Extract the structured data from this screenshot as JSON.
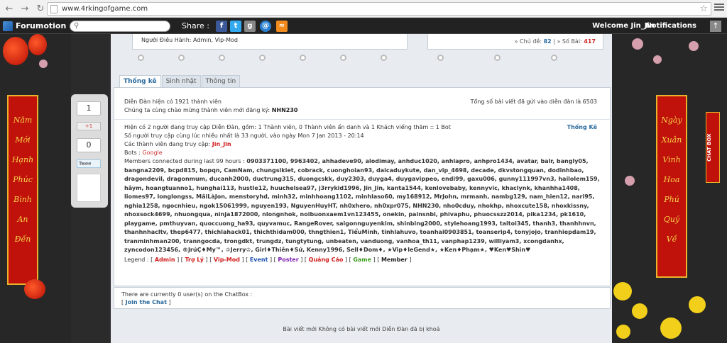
{
  "browser": {
    "url": "www.4rkingofgame.com"
  },
  "forumotion_bar": {
    "logo": "Forumotion",
    "share_label": "Share :",
    "welcome": "Welcome Jin_Jin",
    "notifications": "Notifications"
  },
  "banners": {
    "left": [
      "Năm",
      "Mới",
      "Hạnh",
      "Phúc",
      "Bình",
      "An",
      "Đến"
    ],
    "right": [
      "Ngày",
      "Xuân",
      "Vinh",
      "Hoa",
      "Phú",
      "Quý",
      "Về"
    ],
    "chatbox_label": "CHAT BOX"
  },
  "share_panel": {
    "fb_count": "1",
    "gplus": "+1",
    "gplus_count": "0",
    "tweet": "Twee"
  },
  "top": {
    "moderator_line": "Người Điều Hành: Admin, Vip-Mod",
    "topics_label": "» Chủ đề:",
    "topics_count": "82",
    "posts_label": "» Số Bài:",
    "posts_count": "417"
  },
  "tabs": [
    "Thống kê",
    "Sinh nhật",
    "Thông tin"
  ],
  "stats": {
    "members_line": "Diễn Đàn hiện có 1921 thành viên",
    "total_posts": "Tổng số bài viết đã gửi vào diễn đàn là 6503",
    "newest_member_label": "Chúng ta cùng chào mừng thành viên mới đăng ký:",
    "newest_member": "NHN230",
    "online_line": "Hiện có 2 người đang truy cập Diễn Đàn, gồm: 1 Thành viên, 0 Thành viên ẩn danh và 1 Khách viếng thăm :: 1 Bot",
    "stats_link": "Thống Kê",
    "record_line": "Số người truy cập cùng lúc nhiều nhất là 33 người, vào ngày Mon 7 Jan 2013 - 20:14",
    "current_label": "Các thành viên đang truy cập:",
    "current_user": "Jin_Jin",
    "bots_label": "Bots :",
    "bots_value": "Google",
    "members_99_label": "Members connected during last 99 hours :",
    "members_99": "0903371100, 9963402, ahhadeve90, alodimay, anhduc1020, anhlapro, anhpro1434, avatar, balr, bangly05, bangna2209, bcpd815, bopqn, CamNam, chungsikiet, cobrack, cuonghoian93, daicaduykute, dan_vip_4698, decade, dkvstongquan, dodinhbao, dragondevil, dragonmum, ducanh2000, ductrung315, duongcskk, duy2303, duyga4, duygavippeo, endi99, gaxu006, gunny111997vn3, hailolem159, hâym, hoangtuanno1, hunghai113, hustle12, huuchelsea97, j3rrykid1996, Jin_Jin, kanta1544, kenlovebaby, kennyvic, khaclynk, khanhha1408, liomes97, longlongss, MâiLàJon, menstoryhd, minh32, minhhoang1102, minhlaso60, my168912, MrJohn, mrmanh, nambg129, nam_hien12, nari95, nghia1258, ngocnhieu, ngok15061999, nguyen193, NguyenHuyHT, nh0xhero, nh0xpr075, NHN230, nho0cduy, nhokhp, nhoxcute158, nhoxkissny, nhoxsock4699, nhuongqua, ninja1872000, nlongnhok, noibuonxaem1vn123455, onekin, painsnbi, phivaphu, phuocsszz2014, pika1234, pk1610, playgame, pmthuyvan, quoccuong_ha93, quyvamuc, RangeRover, saigonnguyenkim, shinbing2000, stylehoang1993, taitoi345, thanh3, thanhhnvn, thanhnhacltv, thep6477, thichlahack01, thichthidam000, thngthien1, TiểuMinh, tinhlahuvo, toanhai0903851, toanserip4, tonyjojo, tranhiepdam19, tranminhman200, tranngocda, trongdkt, trungdz, tungtytung, unbeaten, vanduong, vanhoa_th11, vanphap1239, williyam3, xcongdanhx, zyncodon123456, ®JrúÇ♦My™, ♔Jerry♔, Girl♦Thiên♦Sứ, Kenny1996, Sell♦Dom♦, ★Vip♦leGend★, ★Ken♦Phạm★, ♥Ken♥Shin♥",
    "legend_label": "Legend :",
    "legend": [
      {
        "name": "Admin",
        "color": "#d01c1c"
      },
      {
        "name": "Trợ Lý",
        "color": "#d01c1c"
      },
      {
        "name": "Vip-Mod",
        "color": "#d01c1c"
      },
      {
        "name": "Event",
        "color": "#1c4fb0"
      },
      {
        "name": "Poster",
        "color": "#7a1cb0"
      },
      {
        "name": "Quảng Cáo",
        "color": "#d01c1c"
      },
      {
        "name": "Game",
        "color": "#3a9a1c"
      },
      {
        "name": "Member",
        "color": "#222222"
      }
    ]
  },
  "chatbox": {
    "status": "There are currently 0 user(s) on the ChatBox :",
    "join": "Join the Chat"
  },
  "footer": "Bài viết mới Không có bài viết mới Diễn Đàn đã bị khoá"
}
